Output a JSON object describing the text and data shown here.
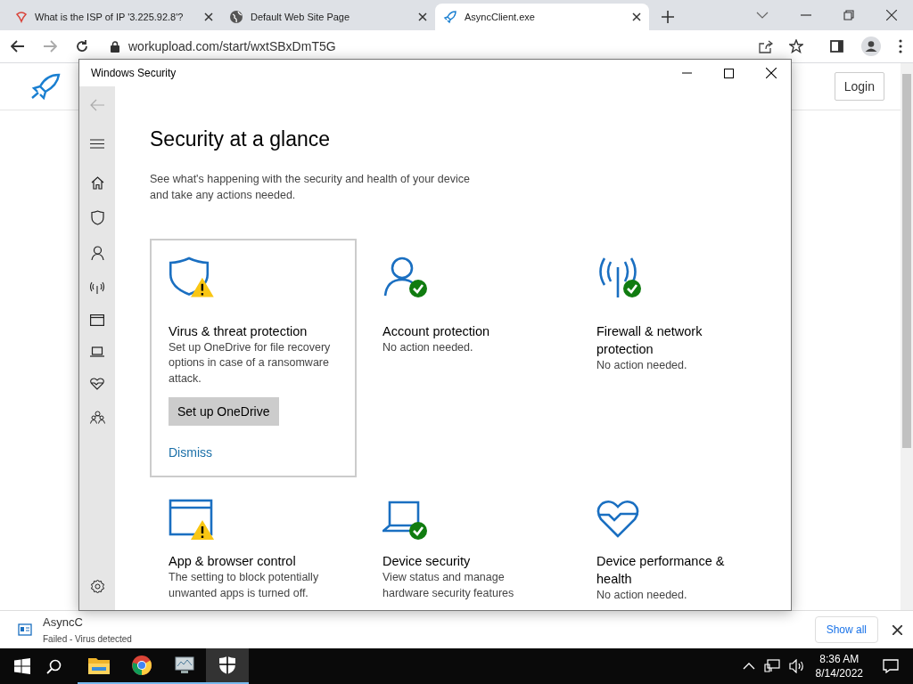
{
  "browser": {
    "tabs": [
      {
        "title": "What is the ISP of IP '3.225.92.8'?",
        "kind": "logo",
        "selected": false
      },
      {
        "title": "Default Web Site Page",
        "kind": "globe",
        "selected": false
      },
      {
        "title": "AsyncClient.exe",
        "kind": "rocket",
        "selected": true
      }
    ],
    "url": "workupload.com/start/wxtSBxDmT5G",
    "page": {
      "login": "Login"
    },
    "downloads": [
      {
        "name": "AsyncC",
        "status": "Failed - Virus detected"
      }
    ],
    "show_all": "Show all"
  },
  "window": {
    "title": "Windows Security",
    "heading": "Security at a glance",
    "subtitle": "See what's happening with the security and health of your device\nand take any actions needed.",
    "cards": [
      {
        "kind": "shield",
        "warning": true,
        "checked": false,
        "selected": true,
        "title": "Virus & threat protection",
        "description": "Set up OneDrive for file recovery options in case of a ransomware attack.",
        "button": "Set up OneDrive",
        "link": "Dismiss"
      },
      {
        "kind": "person",
        "warning": false,
        "checked": true,
        "selected": false,
        "title": "Account protection",
        "description": "No action needed."
      },
      {
        "kind": "antenna",
        "warning": false,
        "checked": true,
        "selected": false,
        "title": "Firewall & network protection",
        "description": "No action needed."
      },
      {
        "kind": "browser",
        "warning": true,
        "checked": false,
        "selected": false,
        "title": "App & browser control",
        "description": "The setting to block potentially unwanted apps is turned off."
      },
      {
        "kind": "laptop",
        "warning": false,
        "checked": true,
        "selected": false,
        "title": "Device security",
        "description": "View status and manage hardware security features"
      },
      {
        "kind": "heart",
        "warning": false,
        "checked": false,
        "selected": false,
        "title": "Device performance & health",
        "description": "No action needed."
      }
    ]
  },
  "taskbar": {
    "apps": [
      {
        "kind": "folder",
        "selected": false
      },
      {
        "kind": "chrome",
        "selected": false
      },
      {
        "kind": "monitor",
        "selected": false
      },
      {
        "kind": "shield",
        "selected": true
      }
    ],
    "time": "8:36 AM",
    "date": "8/14/2022"
  }
}
